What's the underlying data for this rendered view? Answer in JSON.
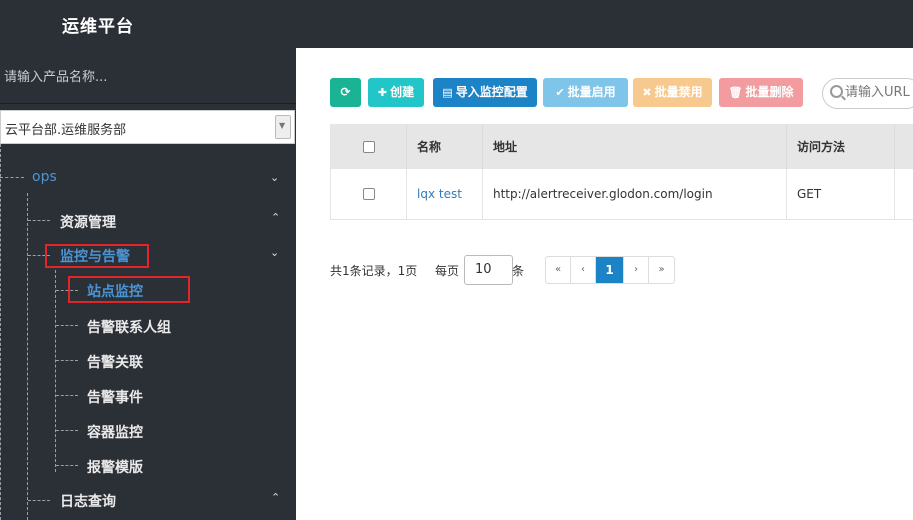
{
  "header": {
    "title": "运维平台"
  },
  "sidebar": {
    "search_placeholder": "请输入产品名称...",
    "org_select": "云平台部.运维服务部",
    "tree": {
      "root": "ops",
      "resource_mgmt": "资源管理",
      "monitor_alert": "监控与告警",
      "site_monitor": "站点监控",
      "alert_contacts": "告警联系人组",
      "alert_relation": "告警关联",
      "alert_events": "告警事件",
      "container_monitor": "容器监控",
      "alert_template": "报警模版",
      "log_query": "日志查询"
    }
  },
  "toolbar": {
    "create": "创建",
    "import": "导入监控配置",
    "batch_enable": "批量启用",
    "batch_disable": "批量禁用",
    "batch_delete": "批量删除",
    "search_placeholder": "请输入URL"
  },
  "table": {
    "headers": [
      "名称",
      "地址",
      "访问方法"
    ],
    "rows": [
      {
        "name": "lqx test",
        "url": "http://alertreceiver.glodon.com/login",
        "method": "GET"
      }
    ]
  },
  "pagination": {
    "summary": "共1条记录，1页",
    "per_page_label": "每页",
    "per_page_value": "10",
    "per_page_unit": "条",
    "first": "«",
    "prev": "‹",
    "current": "1",
    "next": "›",
    "last": "»"
  },
  "colors": {
    "header_bg": "#2b2f36",
    "accent_blue": "#1c84c6",
    "teal": "#23c6c8",
    "highlight_red": "#e0262a"
  }
}
